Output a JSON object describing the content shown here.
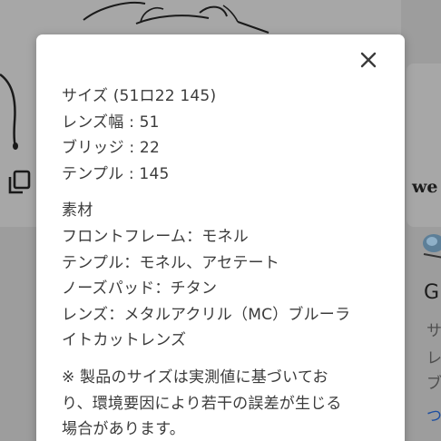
{
  "background": {
    "brand_text": "we",
    "item_initial": "G",
    "side_text_1": "サ",
    "side_text_2": "レ",
    "side_text_3": "ブ",
    "side_link": "つ"
  },
  "dialog": {
    "size": {
      "title": "サイズ (51ロ22 145)",
      "lens_width": "レンズ幅 : 51",
      "bridge": "ブリッジ : 22",
      "temple": "テンプル : 145"
    },
    "material": {
      "heading": "素材",
      "front_frame": "フロントフレーム：モネル",
      "temple": "テンプル：モネル、アセテート",
      "nose_pad": "ノーズパッド：チタン",
      "lens_line1": "レンズ：メタルアクリル（MC）ブルーラ",
      "lens_line2": "イトカットレンズ"
    },
    "note_line1": "※ 製品のサイズは実測値に基づいてお",
    "note_line2": "り、環境要因により若干の誤差が生じる",
    "note_line3": "場合があります。"
  },
  "colors": {
    "overlay": "#9d9d9d",
    "dialog_bg": "#ffffff",
    "text": "#3b3b3b",
    "link": "#1e4fa0"
  },
  "icons": {
    "close": "close-icon",
    "copy": "copy-icon"
  }
}
